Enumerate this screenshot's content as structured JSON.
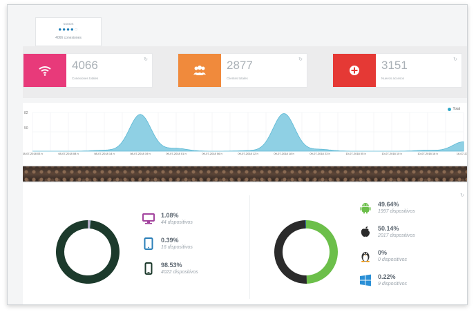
{
  "rating": {
    "title": "SOMOS",
    "stars_filled": 4,
    "stars_total": 5,
    "subtitle": "4066 conexiones"
  },
  "stats": [
    {
      "value": "4066",
      "label": "Conexiones totales",
      "color": "#e83a7a",
      "icon": "wifi-icon"
    },
    {
      "value": "2877",
      "label": "Clientes totales",
      "color": "#f08a3c",
      "icon": "users-icon"
    },
    {
      "value": "3151",
      "label": "Nuevos accesos",
      "color": "#e53935",
      "icon": "plus-circle-icon"
    }
  ],
  "timeline": {
    "legend": "Total",
    "color": "#2fa8c8",
    "y_ticks": [
      "82",
      "50"
    ],
    "x_ticks": [
      "08-07-2018 03 h",
      "08-07-2018 08 h",
      "08-07-2018 14 h",
      "08-07-2018 19 h",
      "09-07-2018 01 h",
      "09-07-2018 06 h",
      "09-07-2018 12 h",
      "09-07-2018 18 h",
      "09-07-2018 23 h",
      "10-07-2018 05 h",
      "10-07-2018 10 h",
      "10-07-2018 16 h",
      "16-07-2018"
    ]
  },
  "chart_data": {
    "type": "area",
    "x": [
      "08-07-2018 03 h",
      "08-07-2018 08 h",
      "08-07-2018 14 h",
      "08-07-2018 19 h",
      "09-07-2018 01 h",
      "09-07-2018 06 h",
      "09-07-2018 12 h",
      "09-07-2018 18 h",
      "09-07-2018 23 h",
      "10-07-2018 05 h",
      "10-07-2018 10 h",
      "10-07-2018 16 h",
      "16-07-2018"
    ],
    "series": [
      {
        "name": "Total",
        "values": [
          0,
          0,
          2,
          78,
          6,
          0,
          1,
          80,
          4,
          0,
          0,
          2,
          20
        ]
      }
    ],
    "ylim": [
      0,
      82
    ],
    "grid": true,
    "legend_position": "top-right"
  },
  "devices": [
    {
      "pct": "1.08%",
      "count": "44 dispositivos",
      "icon": "desktop-icon",
      "color": "#a3449e"
    },
    {
      "pct": "0.39%",
      "count": "16 dispositivos",
      "icon": "tablet-icon",
      "color": "#2a7fb8"
    },
    {
      "pct": "98.53%",
      "count": "4022 dispositivos",
      "icon": "mobile-icon",
      "color": "#1c3a2c"
    }
  ],
  "devices_chart": {
    "colors": [
      "#b0a8c0",
      "#9fb8d0",
      "#1c3a2c"
    ],
    "values": [
      1.08,
      0.39,
      98.53
    ]
  },
  "os": [
    {
      "pct": "49.64%",
      "count": "1997 dispositivos",
      "icon": "android-icon",
      "color": "#6cbf4a"
    },
    {
      "pct": "50.14%",
      "count": "2017 dispositivos",
      "icon": "apple-icon",
      "color": "#2b2b2b"
    },
    {
      "pct": "0%",
      "count": "0 dispositivos",
      "icon": "linux-icon",
      "color": "#333"
    },
    {
      "pct": "0.22%",
      "count": "9 dispositivos",
      "icon": "windows-icon",
      "color": "#2a8fd6"
    }
  ],
  "os_chart": {
    "colors": [
      "#6cbf4a",
      "#2b2b2b",
      "#f39c12",
      "#2a8fd6"
    ],
    "values": [
      49.64,
      50.14,
      0,
      0.22
    ]
  }
}
